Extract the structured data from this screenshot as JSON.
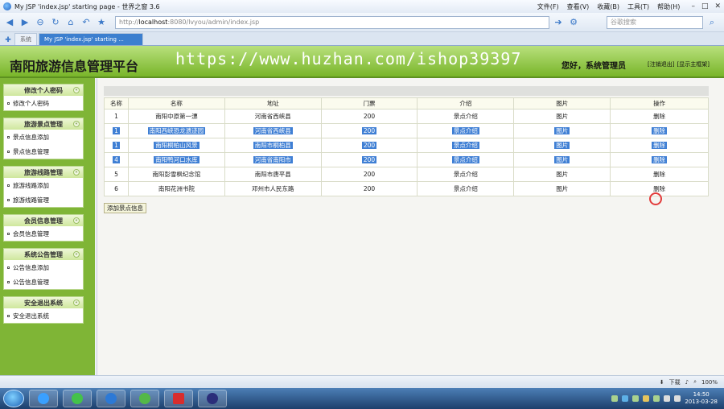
{
  "browser": {
    "window_title": "My JSP 'index.jsp' starting page - 世界之窗 3.6",
    "menus": [
      "文件(F)",
      "查看(V)",
      "收藏(B)",
      "工具(T)",
      "帮助(H)"
    ],
    "address_prefix": "http://",
    "address_host": "localhost",
    "address_rest": ":8080/lvyou/admin/index.jsp",
    "search_placeholder": "谷歌搜索",
    "tabs": [
      "系统",
      "My JSP 'index.jsp' starting ..."
    ],
    "zoom": "100%",
    "download_label": "下载"
  },
  "app": {
    "title": "南阳旅游信息管理平台",
    "watermark": "https://www.huzhan.com/ishop39397",
    "greeting": "您好，系统管理员",
    "logout_link": "[注销退出]",
    "home_link": "[显示主框架]"
  },
  "sidebar": [
    {
      "title": "修改个人密码",
      "items": [
        "修改个人密码"
      ]
    },
    {
      "title": "旅游景点管理",
      "items": [
        "景点信息添加",
        "景点信息管理"
      ]
    },
    {
      "title": "旅游线路管理",
      "items": [
        "旅游线路添加",
        "旅游线路管理"
      ]
    },
    {
      "title": "会员信息管理",
      "items": [
        "会员信息管理"
      ]
    },
    {
      "title": "系统公告管理",
      "items": [
        "公告信息添加",
        "公告信息管理"
      ]
    },
    {
      "title": "安全退出系统",
      "items": [
        "安全退出系统"
      ]
    }
  ],
  "table": {
    "headers": [
      "名称",
      "名称",
      "地址",
      "门票",
      "介绍",
      "图片",
      "操作"
    ],
    "rows": [
      {
        "no": "1",
        "name": "南阳中原第一漂",
        "addr": "河南省西峡县",
        "ticket": "200",
        "intro": "景点介绍",
        "pic": "图片",
        "op": "删除",
        "selected": false
      },
      {
        "no": "1",
        "name": "南阳西峡恐龙遗迹园",
        "addr": "河南省西峡县",
        "ticket": "200",
        "intro": "景点介绍",
        "pic": "图片",
        "op": "删除",
        "selected": true
      },
      {
        "no": "1",
        "name": "南阳桐柏山风景",
        "addr": "南阳市桐柏县",
        "ticket": "200",
        "intro": "景点介绍",
        "pic": "图片",
        "op": "删除",
        "selected": true
      },
      {
        "no": "4",
        "name": "南阳鸭河口水库",
        "addr": "河南省南阳市",
        "ticket": "200",
        "intro": "景点介绍",
        "pic": "图片",
        "op": "删除",
        "selected": true
      },
      {
        "no": "5",
        "name": "南阳彭雪枫纪念馆",
        "addr": "南阳市唐平县",
        "ticket": "200",
        "intro": "景点介绍",
        "pic": "图片",
        "op": "删除",
        "selected": false
      },
      {
        "no": "6",
        "name": "南阳花洲书院",
        "addr": "邓州市人民东路",
        "ticket": "200",
        "intro": "景点介绍",
        "pic": "图片",
        "op": "删除",
        "selected": false
      }
    ]
  },
  "add_button_label": "添加景点信息",
  "taskbar": {
    "time": "14:50",
    "date": "2013-03-28"
  }
}
